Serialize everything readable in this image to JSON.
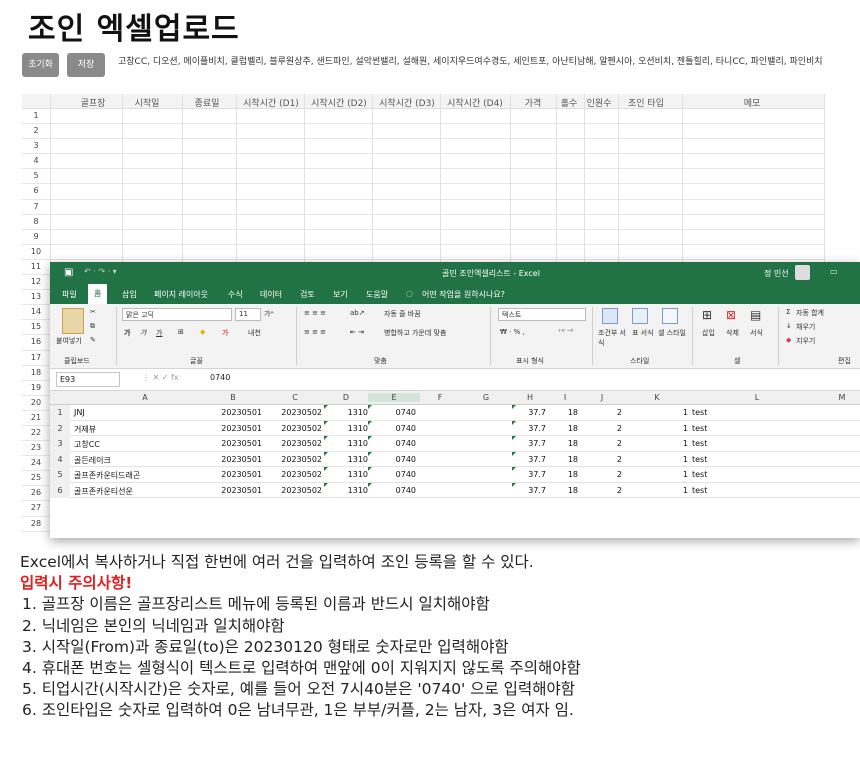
{
  "page_title": "조인 엑셀업로드",
  "toolbar": {
    "reset_label": "초기화",
    "save_label": "저장"
  },
  "course_list": "고창CC, 디오션, 메이플비치, 클럽벨리, 블루원상주, 샌드파인, 설악썬밸리, 설해원, 세이지우드여수경도, 세인트포, 아난티남해, 알펜시아, 오션비치, 젠틀힐리, 타니CC, 파인밸리, 파인비치",
  "grid": {
    "headers": [
      "골프장",
      "시작일",
      "종료일",
      "시작시간 (D1)",
      "시작시간 (D2)",
      "시작시간 (D3)",
      "시작시간 (D4)",
      "가격",
      "홀수",
      "인원수",
      "조인 타입",
      "메모"
    ],
    "row_numbers": [
      "1",
      "2",
      "3",
      "4",
      "5",
      "6",
      "7",
      "8",
      "9",
      "10",
      "11",
      "12",
      "13",
      "14",
      "15",
      "16",
      "17",
      "18",
      "19",
      "20",
      "21",
      "22",
      "23",
      "24",
      "25",
      "26",
      "27",
      "28"
    ]
  },
  "excel": {
    "title": "골민 조인엑셀리스트 - Excel",
    "user": "정 민선",
    "tabs": [
      "파일",
      "홈",
      "삽입",
      "페이지 레이아웃",
      "수식",
      "데이터",
      "검토",
      "보기",
      "도움말",
      "어떤 작업을 원하시나요?"
    ],
    "font_name": "맑은 고딕",
    "font_size": "11",
    "number_format": "텍스트",
    "ribbon": {
      "paste": "붙여넣기",
      "wrap": "자동 줄 바꿈",
      "merge": "병합하고 가운데 맞춤",
      "cond_format": "조건부 서식",
      "table_format": "표 서식",
      "cell_style": "셀 스타일",
      "insert": "삽입",
      "delete": "삭제",
      "format": "서식",
      "autosum": "자동 합계",
      "fill": "채우기",
      "clear": "지우기",
      "groups": [
        "클립보드",
        "글꼴",
        "맞춤",
        "표시 형식",
        "스타일",
        "셀",
        "편집"
      ]
    },
    "name_box": "E93",
    "formula": "0740",
    "col_headers": [
      "A",
      "B",
      "C",
      "D",
      "E",
      "F",
      "G",
      "H",
      "I",
      "J",
      "K",
      "L",
      "M"
    ],
    "rows": [
      [
        "1",
        "JNJ",
        "20230501",
        "20230502",
        "1310",
        "0740",
        "37.7",
        "18",
        "2",
        "1",
        "test"
      ],
      [
        "2",
        "거제뷰",
        "20230501",
        "20230502",
        "1310",
        "0740",
        "37.7",
        "18",
        "2",
        "1",
        "test"
      ],
      [
        "3",
        "고창CC",
        "20230501",
        "20230502",
        "1310",
        "0740",
        "37.7",
        "18",
        "2",
        "1",
        "test"
      ],
      [
        "4",
        "골든레이크",
        "20230501",
        "20230502",
        "1310",
        "0740",
        "37.7",
        "18",
        "2",
        "1",
        "test"
      ],
      [
        "5",
        "골프존카운티드래곤",
        "20230501",
        "20230502",
        "1310",
        "0740",
        "37.7",
        "18",
        "2",
        "1",
        "test"
      ],
      [
        "6",
        "골프존카운티선운",
        "20230501",
        "20230502",
        "1310",
        "0740",
        "37.7",
        "18",
        "2",
        "1",
        "test"
      ]
    ]
  },
  "notes": {
    "intro": "Excel에서 복사하거나 직접 한번에 여러 건을 입력하여 조인 등록을 할 수 있다.",
    "warning": "입력시 주의사항!",
    "items": [
      "1. 골프장 이름은 골프장리스트 메뉴에 등록된 이름과 반드시 일치해야함",
      "2. 닉네임은 본인의 닉네임과 일치해야함",
      "3. 시작일(From)과 종료일(to)은 20230120 형태로 숫자로만 입력해야함",
      "4. 휴대폰 번호는 셀형식이 텍스트로 입력하여 맨앞에 0이 지워지지 않도록 주의해야함",
      "5. 티업시간(시작시간)은 숫자로, 예를 들어 오전 7시40분은 '0740' 으로 입력해야함",
      "6. 조인타입은 숫자로 입력하여 0은 남녀무관, 1은 부부/커플, 2는 남자, 3은 여자 임."
    ]
  },
  "colors": {
    "excel_green": "#217346",
    "button_gray": "#8a8a8a",
    "warning_red": "#e02020"
  }
}
